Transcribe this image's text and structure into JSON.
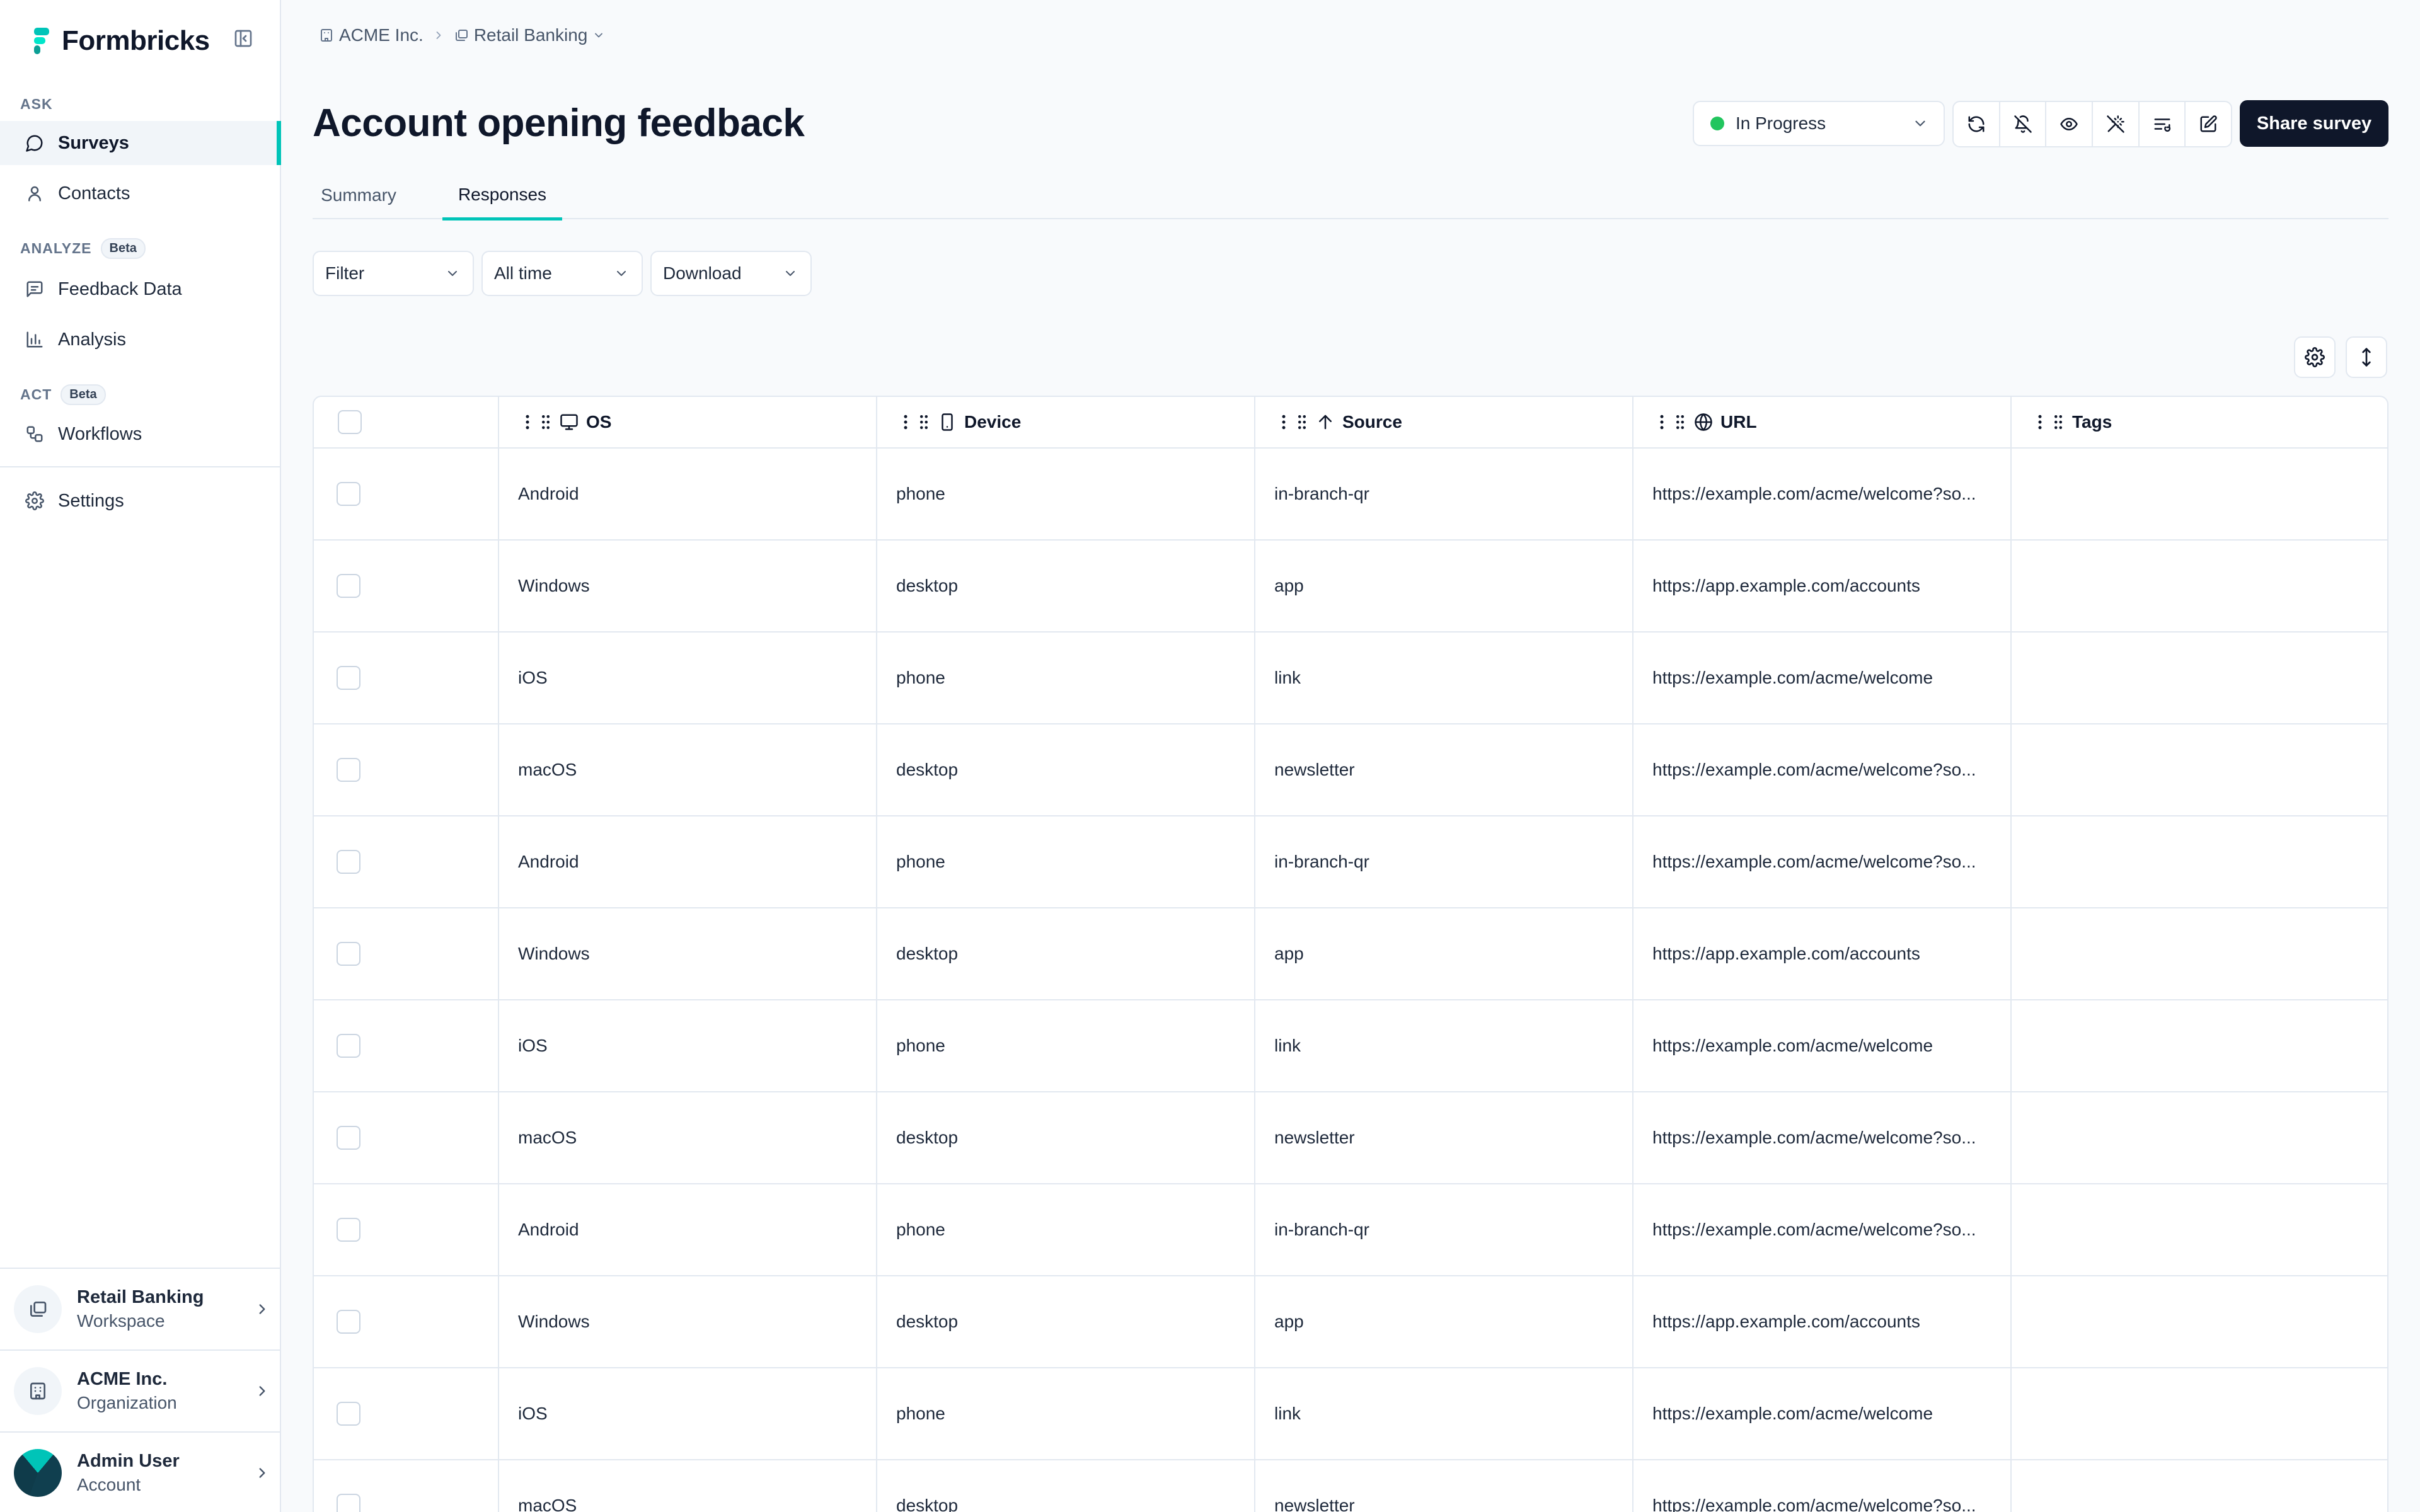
{
  "brand": {
    "name": "Formbricks"
  },
  "sidebar": {
    "sections": [
      {
        "label": "ASK",
        "beta": ""
      },
      {
        "label": "ANALYZE",
        "beta": "Beta"
      },
      {
        "label": "ACT",
        "beta": "Beta"
      }
    ],
    "items": [
      {
        "label": "Surveys",
        "icon": "message-circle-icon",
        "active": true
      },
      {
        "label": "Contacts",
        "icon": "user-icon"
      },
      {
        "label": "Feedback Data",
        "icon": "message-square-text-icon"
      },
      {
        "label": "Analysis",
        "icon": "bar-chart-icon"
      },
      {
        "label": "Workflows",
        "icon": "workflow-icon"
      },
      {
        "label": "Settings",
        "icon": "gear-icon"
      }
    ],
    "workspace": {
      "title": "Retail Banking",
      "subtitle": "Workspace"
    },
    "organization": {
      "title": "ACME Inc.",
      "subtitle": "Organization"
    },
    "account": {
      "title": "Admin User",
      "subtitle": "Account"
    }
  },
  "breadcrumb": {
    "org": "ACME Inc.",
    "workspace": "Retail Banking"
  },
  "page": {
    "title": "Account opening feedback"
  },
  "status": {
    "label": "In Progress",
    "color": "#22c55e"
  },
  "toolbar": {
    "icons": [
      "refresh-icon",
      "bell-off-icon",
      "eye-icon",
      "wand-off-icon",
      "list-filter-icon",
      "edit-icon"
    ],
    "share_label": "Share survey"
  },
  "tabs": [
    {
      "label": "Summary",
      "active": false
    },
    {
      "label": "Responses",
      "active": true
    }
  ],
  "filters": {
    "filter": "Filter",
    "time": "All time",
    "download": "Download"
  },
  "table": {
    "columns": [
      {
        "label": "OS",
        "icon": "monitor-icon"
      },
      {
        "label": "Device",
        "icon": "smartphone-icon"
      },
      {
        "label": "Source",
        "icon": "arrow-up-icon"
      },
      {
        "label": "URL",
        "icon": "globe-icon"
      },
      {
        "label": "Tags",
        "icon": ""
      }
    ],
    "rows": [
      {
        "os": "Android",
        "device": "phone",
        "source": "in-branch-qr",
        "url": "https://example.com/acme/welcome?so...",
        "tags": ""
      },
      {
        "os": "Windows",
        "device": "desktop",
        "source": "app",
        "url": "https://app.example.com/accounts",
        "tags": ""
      },
      {
        "os": "iOS",
        "device": "phone",
        "source": "link",
        "url": "https://example.com/acme/welcome",
        "tags": ""
      },
      {
        "os": "macOS",
        "device": "desktop",
        "source": "newsletter",
        "url": "https://example.com/acme/welcome?so...",
        "tags": ""
      },
      {
        "os": "Android",
        "device": "phone",
        "source": "in-branch-qr",
        "url": "https://example.com/acme/welcome?so...",
        "tags": ""
      },
      {
        "os": "Windows",
        "device": "desktop",
        "source": "app",
        "url": "https://app.example.com/accounts",
        "tags": ""
      },
      {
        "os": "iOS",
        "device": "phone",
        "source": "link",
        "url": "https://example.com/acme/welcome",
        "tags": ""
      },
      {
        "os": "macOS",
        "device": "desktop",
        "source": "newsletter",
        "url": "https://example.com/acme/welcome?so...",
        "tags": ""
      },
      {
        "os": "Android",
        "device": "phone",
        "source": "in-branch-qr",
        "url": "https://example.com/acme/welcome?so...",
        "tags": ""
      },
      {
        "os": "Windows",
        "device": "desktop",
        "source": "app",
        "url": "https://app.example.com/accounts",
        "tags": ""
      },
      {
        "os": "iOS",
        "device": "phone",
        "source": "link",
        "url": "https://example.com/acme/welcome",
        "tags": ""
      },
      {
        "os": "macOS",
        "device": "desktop",
        "source": "newsletter",
        "url": "https://example.com/acme/welcome?so...",
        "tags": ""
      }
    ]
  }
}
